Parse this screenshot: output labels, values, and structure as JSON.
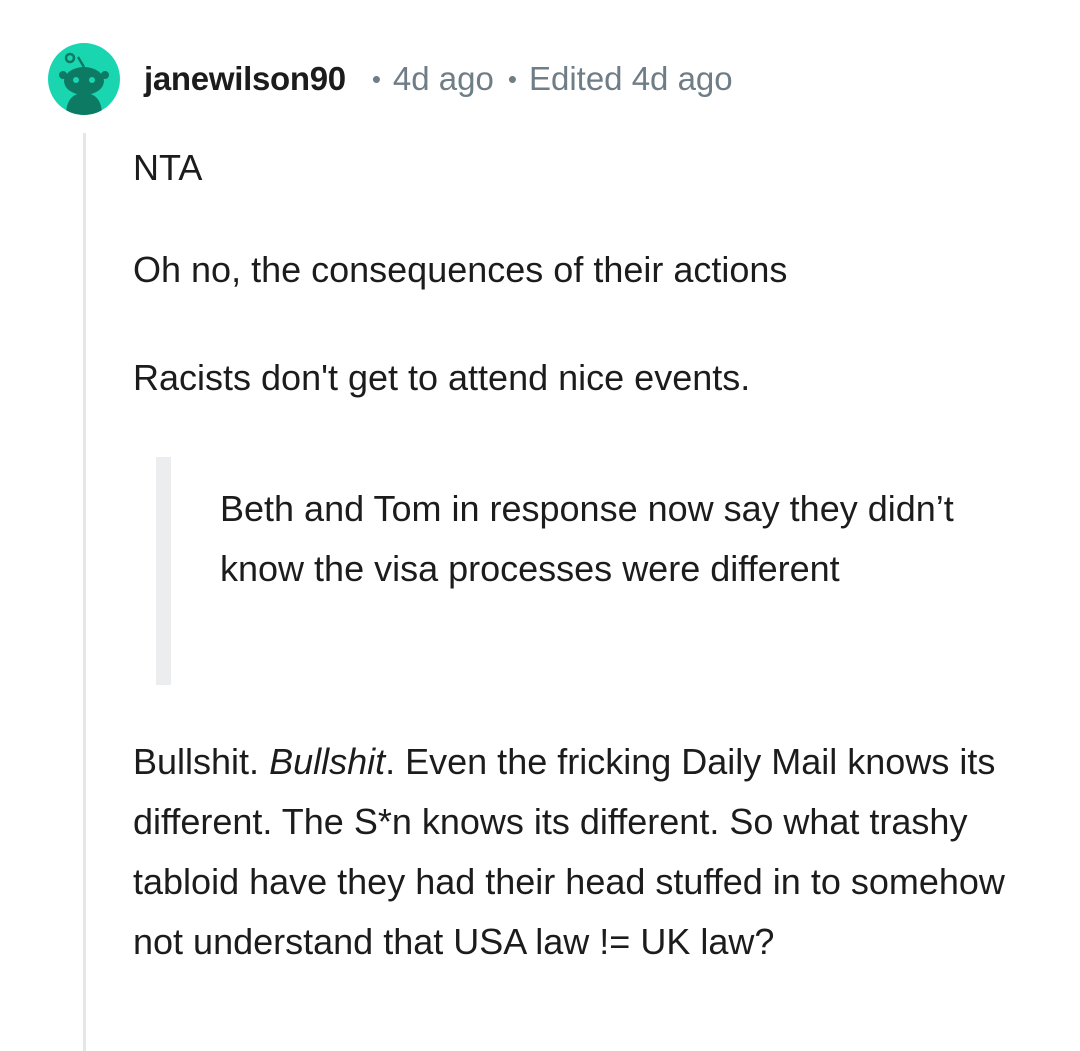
{
  "comment": {
    "username": "janewilson90",
    "separator": "•",
    "age": "4d ago",
    "edited": "Edited 4d ago",
    "avatar_icon": "reddit-snoo-avatar-icon",
    "avatar_color": "#19d6b1",
    "paragraphs": {
      "verdict": "NTA",
      "line1": "Oh no, the consequences of their actions",
      "line2": "Racists don't get to attend nice events."
    },
    "quote": "Beth and Tom in response now say they didn’t know the visa processes were different",
    "final": {
      "part1": "Bullshit. ",
      "italic": "Bullshit",
      "part2": ". Even the fricking Daily Mail knows its different. The S*n knows its different. So what trashy tabloid have they had their head stuffed in to somehow not understand that USA law != UK law?"
    }
  }
}
